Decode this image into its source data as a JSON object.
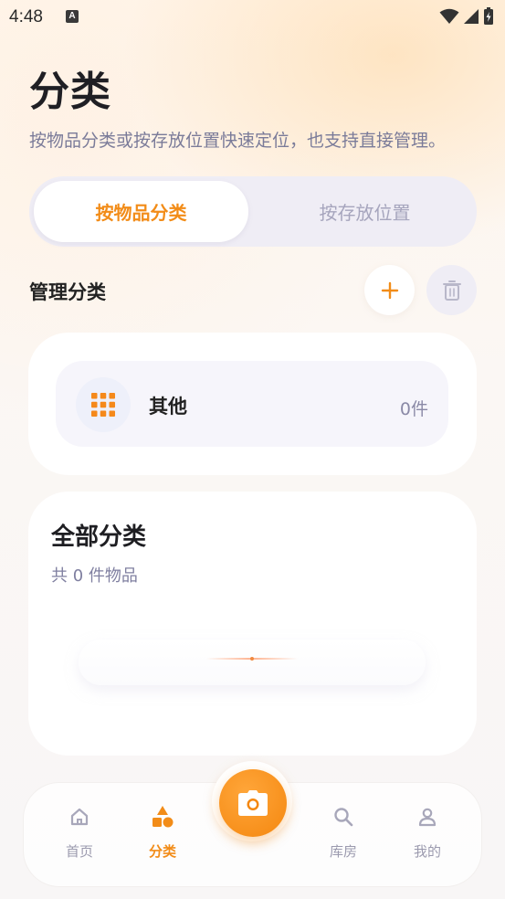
{
  "status_bar": {
    "time": "4:48",
    "notification_badge": "A"
  },
  "header": {
    "title": "分类",
    "subtitle": "按物品分类或按存放位置快速定位，也支持直接管理。"
  },
  "segment": {
    "tabs": [
      {
        "label": "按物品分类",
        "active": true
      },
      {
        "label": "按存放位置",
        "active": false
      }
    ]
  },
  "manage": {
    "label": "管理分类",
    "add_icon": "plus-icon",
    "delete_icon": "trash-icon"
  },
  "categories": [
    {
      "name": "其他",
      "count": "0件",
      "icon": "grid-icon"
    }
  ],
  "all_categories": {
    "title": "全部分类",
    "summary": "共 0 件物品"
  },
  "bottom_nav": {
    "items": [
      {
        "label": "首页",
        "icon": "home-icon",
        "active": false
      },
      {
        "label": "分类",
        "icon": "shapes-icon",
        "active": true
      },
      {
        "label": "库房",
        "icon": "search-icon",
        "active": false
      },
      {
        "label": "我的",
        "icon": "user-icon",
        "active": false
      }
    ],
    "camera_icon": "camera-icon"
  },
  "colors": {
    "accent": "#f28c18",
    "muted_text": "#7a7b99",
    "segment_bg": "#efedf5"
  }
}
